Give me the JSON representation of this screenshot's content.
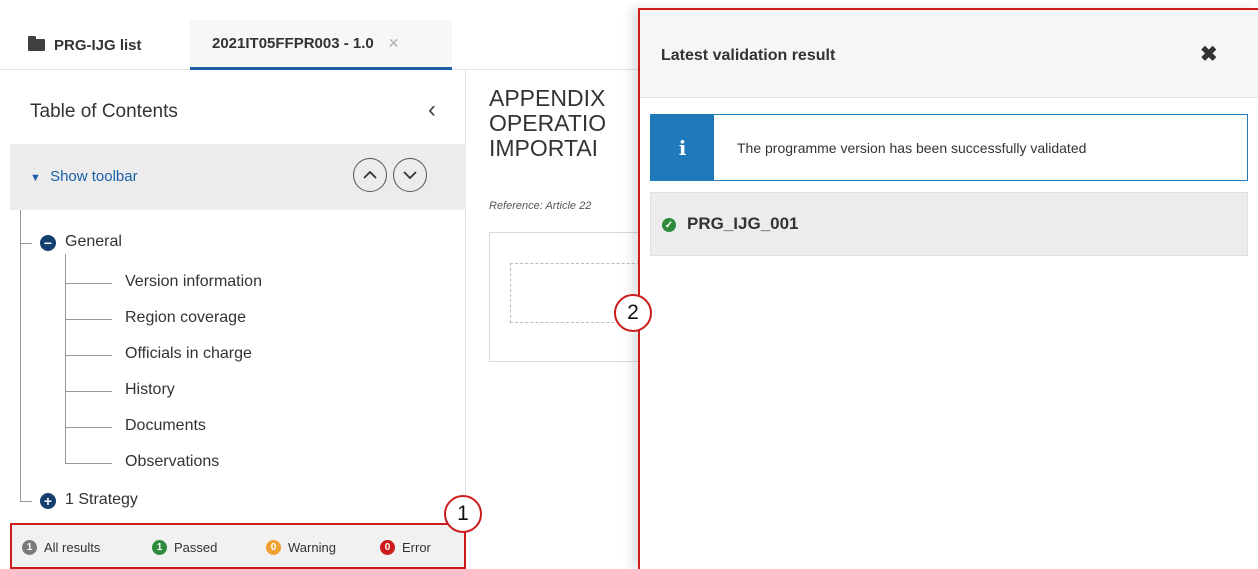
{
  "tabs": [
    {
      "label": "PRG-IJG list",
      "icon": "folder-icon"
    },
    {
      "label": "2021IT05FFPR003 - 1.0",
      "close_glyph": "✕"
    }
  ],
  "sidebar": {
    "title": "Table of Contents",
    "collapse_glyph": "‹",
    "show_toolbar": "Show toolbar",
    "tree": {
      "general": {
        "label": "General",
        "children": [
          "Version information",
          "Region coverage",
          "Officials in charge",
          "History",
          "Documents",
          "Observations"
        ]
      },
      "strategy": {
        "label": "1 Strategy"
      }
    },
    "results": {
      "all": {
        "count": "1",
        "label": "All results",
        "color": "#7a7a7a"
      },
      "passed": {
        "count": "1",
        "label": "Passed",
        "color": "#2e8b3d"
      },
      "warning": {
        "count": "0",
        "label": "Warning",
        "color": "#f0a030"
      },
      "error": {
        "count": "0",
        "label": "Error",
        "color": "#cc1b1b"
      }
    }
  },
  "main": {
    "heading": "APPENDIX\nOPERATIO\nIMPORTAI",
    "reference": "Reference: Article 22"
  },
  "panel": {
    "title": "Latest validation result",
    "close_glyph": "✖",
    "info_message": "The programme version has been successfully validated",
    "result_label": "PRG_IJG_001"
  },
  "callouts": [
    "1",
    "2"
  ],
  "colors": {
    "accent": "#1a5fa8",
    "navy": "#123f6d",
    "callout_red": "#cc1b1b",
    "info_blue": "#1f7abb"
  }
}
